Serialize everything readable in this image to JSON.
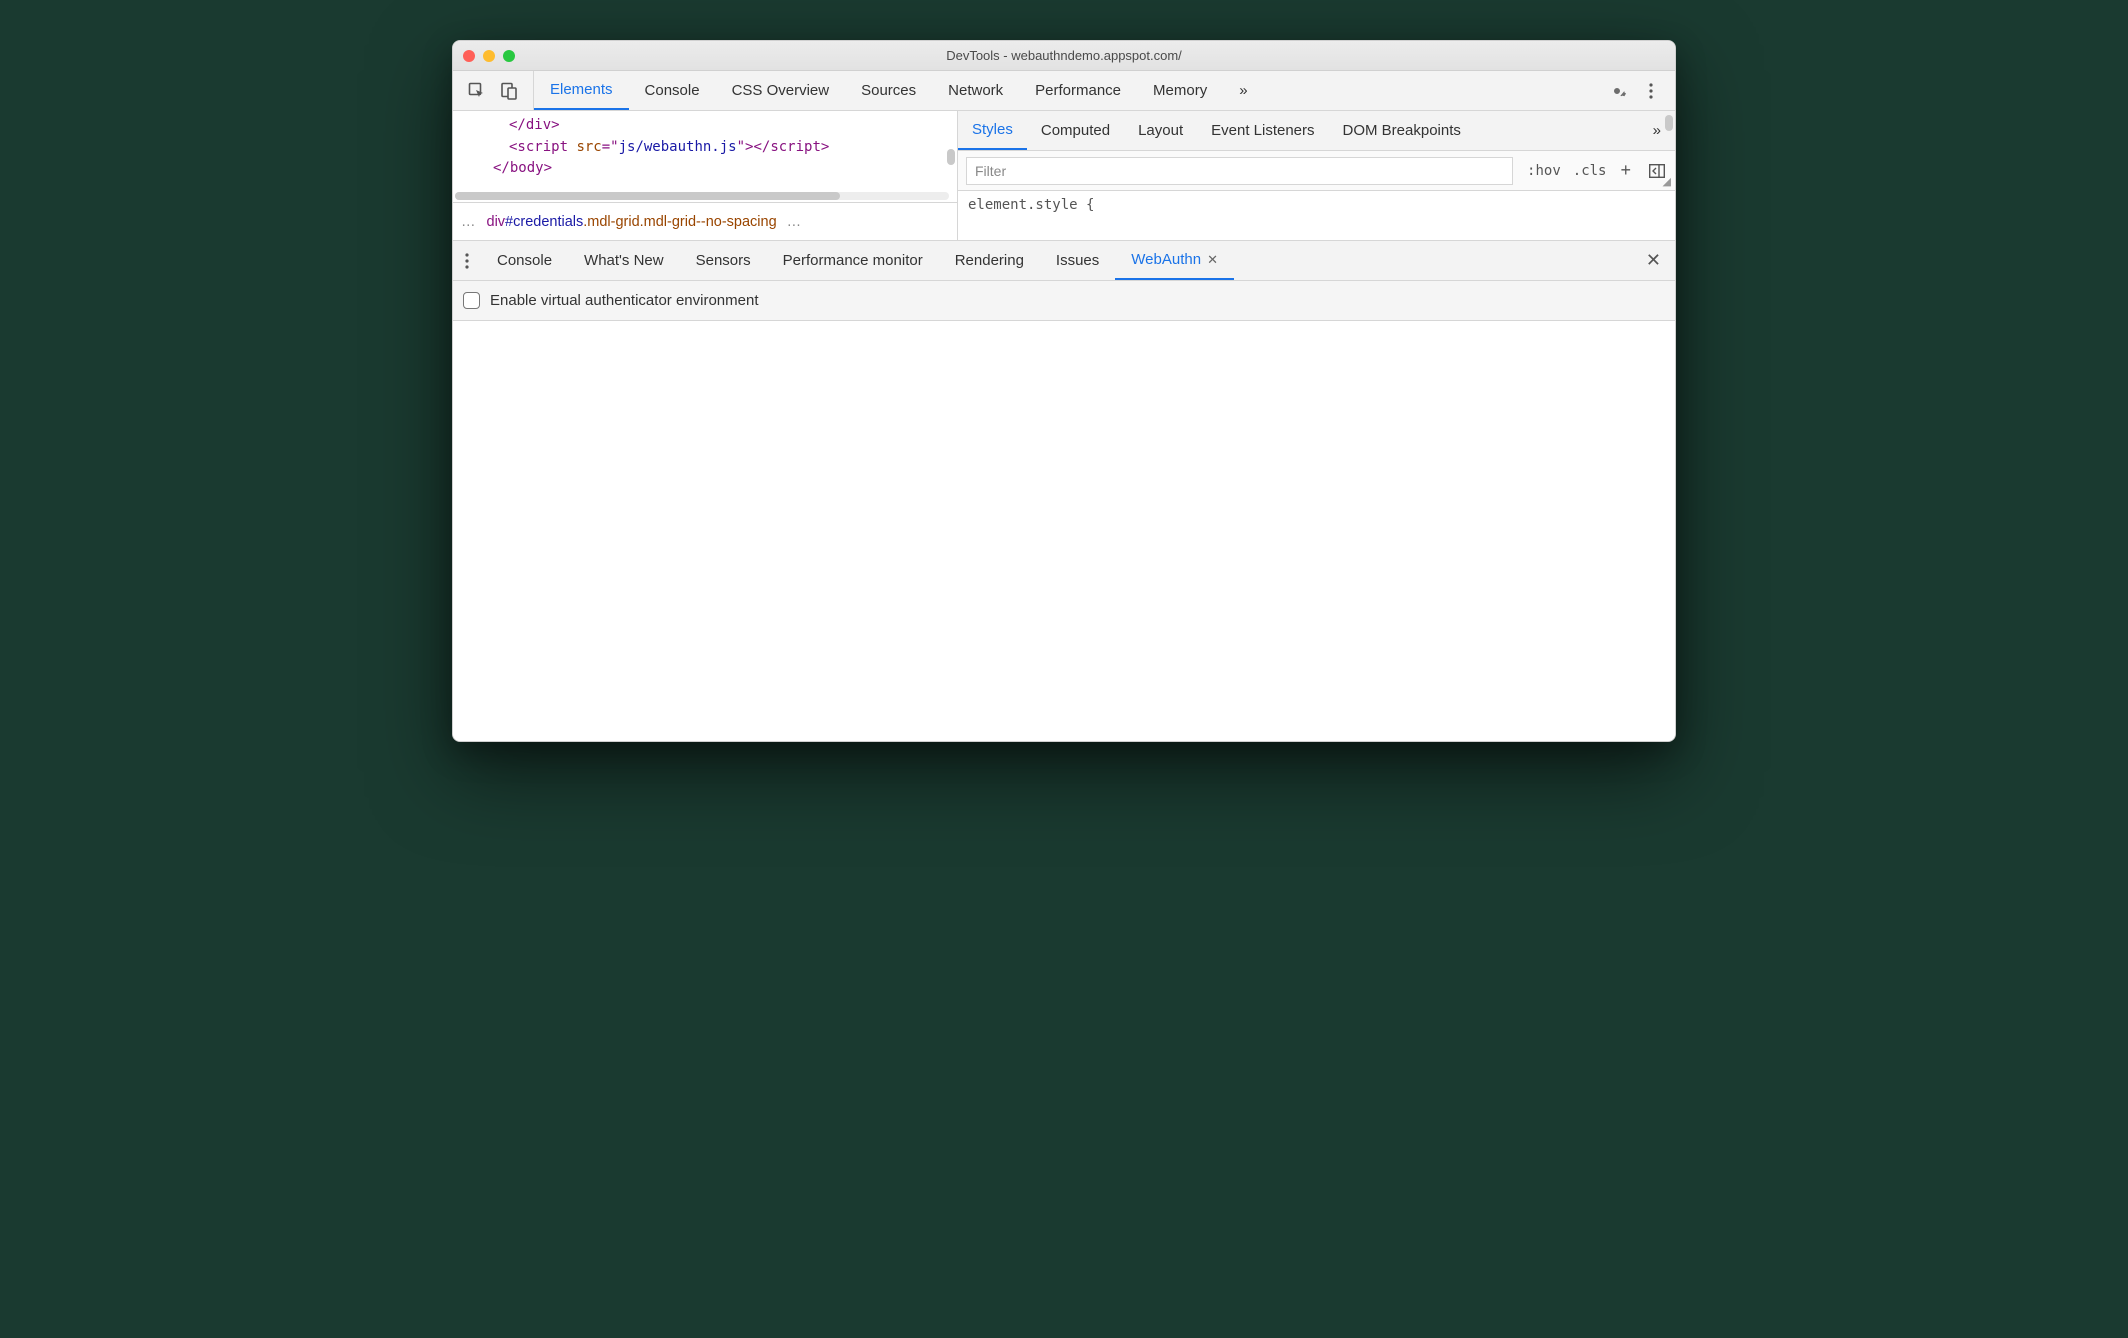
{
  "window": {
    "title": "DevTools - webauthndemo.appspot.com/"
  },
  "main_tabs": {
    "items": [
      "Elements",
      "Console",
      "CSS Overview",
      "Sources",
      "Network",
      "Performance",
      "Memory"
    ],
    "active": 0
  },
  "code": {
    "line1_a": "</div>",
    "line2_open": "<script ",
    "line2_attr": "src",
    "line2_eq": "=\"",
    "line2_val": "js/webauthn.js",
    "line2_close": "\"></scr",
    "line2_close2": "ipt>",
    "line3": "</body>"
  },
  "breadcrumb": {
    "tag": "div",
    "id": "#credentials",
    "cls": ".mdl-grid.mdl-grid--no-spacing"
  },
  "styles_tabs": {
    "items": [
      "Styles",
      "Computed",
      "Layout",
      "Event Listeners",
      "DOM Breakpoints"
    ],
    "active": 0
  },
  "filter": {
    "placeholder": "Filter",
    "hov": ":hov",
    "cls": ".cls"
  },
  "style_body": "element.style {",
  "drawer_tabs": {
    "items": [
      "Console",
      "What's New",
      "Sensors",
      "Performance monitor",
      "Rendering",
      "Issues",
      "WebAuthn"
    ],
    "active": 6
  },
  "webauthn": {
    "checkbox_label": "Enable virtual authenticator environment"
  }
}
